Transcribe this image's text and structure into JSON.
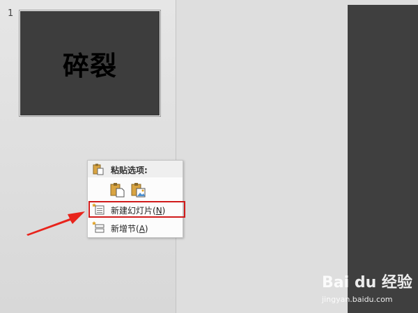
{
  "thumbnails": {
    "slide_number": "1",
    "slide_title": "碎裂"
  },
  "context_menu": {
    "paste_header": "粘贴选项:",
    "new_slide": {
      "label": "新建幻灯片(",
      "accel": "N",
      "close": ")"
    },
    "new_section": {
      "label": "新增节(",
      "accel": "A",
      "close": ")"
    }
  },
  "watermark": {
    "brand": "Bai du 经验",
    "url": "jingyan.baidu.com"
  },
  "colors": {
    "highlight": "#d01a1a",
    "arrow": "#e8241c",
    "slide_bg": "#3d3d3d"
  }
}
